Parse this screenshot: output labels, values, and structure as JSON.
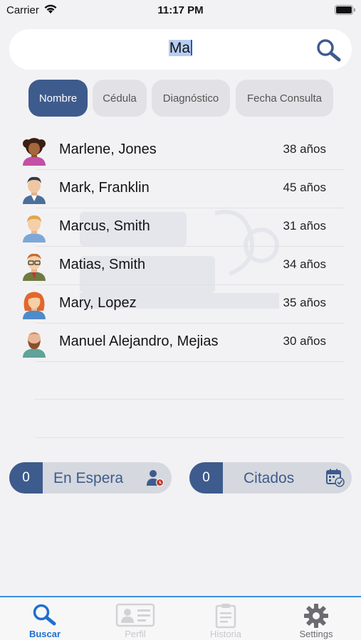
{
  "status_bar": {
    "carrier": "Carrier",
    "time": "11:17 PM"
  },
  "search": {
    "value_selected": "Ma",
    "icon": "search-icon"
  },
  "filters": [
    {
      "label": "Nombre",
      "active": true
    },
    {
      "label": "Cédula",
      "active": false
    },
    {
      "label": "Diagnóstico",
      "active": false
    },
    {
      "label": "Fecha Consulta",
      "active": false
    }
  ],
  "patients": [
    {
      "name": "Marlene, Jones",
      "age": "38 años",
      "avatar": "woman-curly-avatar"
    },
    {
      "name": "Mark, Franklin",
      "age": "45 años",
      "avatar": "man-suit-avatar"
    },
    {
      "name": "Marcus, Smith",
      "age": "31 años",
      "avatar": "man-blond-avatar"
    },
    {
      "name": "Matias, Smith",
      "age": "34 años",
      "avatar": "man-glasses-avatar"
    },
    {
      "name": "Mary, Lopez",
      "age": "35 años",
      "avatar": "woman-redhead-avatar"
    },
    {
      "name": "Manuel Alejandro, Mejias",
      "age": "30 años",
      "avatar": "man-bearded-avatar"
    }
  ],
  "counters": {
    "waiting": {
      "count": "0",
      "label": "En Espera",
      "icon": "person-clock-icon"
    },
    "scheduled": {
      "count": "0",
      "label": "Citados",
      "icon": "calendar-check-icon"
    }
  },
  "tabs": [
    {
      "label": "Buscar",
      "icon": "search-icon",
      "state": "active"
    },
    {
      "label": "Perfil",
      "icon": "id-card-icon",
      "state": "disabled"
    },
    {
      "label": "Historia",
      "icon": "clipboard-icon",
      "state": "disabled"
    },
    {
      "label": "Settings",
      "icon": "gear-icon",
      "state": "normal"
    }
  ],
  "colors": {
    "accent": "#3e5b8d",
    "tab_active": "#1e6fd0",
    "background": "#f2f2f4",
    "chip_inactive": "#e2e2e6",
    "counter_bg": "#d5d8de"
  }
}
